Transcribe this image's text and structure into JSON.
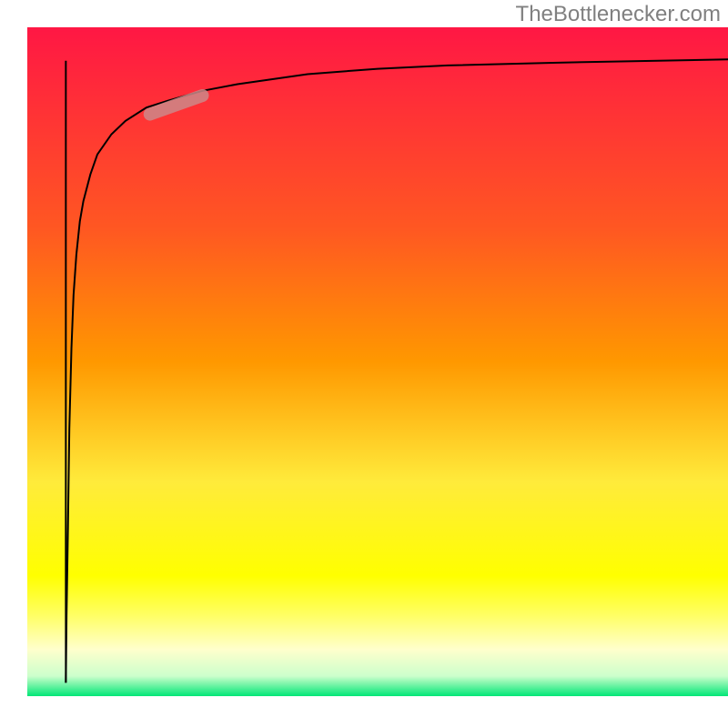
{
  "watermark": "TheBottlenecker.com",
  "chart_data": {
    "type": "line",
    "title": "",
    "xlabel": "",
    "ylabel": "",
    "xlim": [
      0,
      100
    ],
    "ylim": [
      0,
      100
    ],
    "background_gradient": {
      "stops": [
        {
          "offset": 0,
          "color": "#ff1744"
        },
        {
          "offset": 0.3,
          "color": "#ff5722"
        },
        {
          "offset": 0.5,
          "color": "#ff9800"
        },
        {
          "offset": 0.68,
          "color": "#ffeb3b"
        },
        {
          "offset": 0.82,
          "color": "#ffff00"
        },
        {
          "offset": 0.88,
          "color": "#ffff66"
        },
        {
          "offset": 0.93,
          "color": "#ffffcc"
        },
        {
          "offset": 0.97,
          "color": "#ccffcc"
        },
        {
          "offset": 1.0,
          "color": "#00e676"
        }
      ]
    },
    "series": [
      {
        "name": "curve",
        "type": "line",
        "color": "#000000",
        "width": 2,
        "x": [
          5.5,
          5.6,
          5.8,
          6.0,
          6.3,
          6.6,
          7.0,
          7.5,
          8.0,
          9.0,
          10.0,
          12.0,
          14.0,
          17.0,
          20.0,
          25.0,
          30.0,
          40.0,
          50.0,
          60.0,
          75.0,
          90.0,
          100.0
        ],
        "y": [
          2.0,
          12.0,
          25.0,
          40.0,
          52.0,
          60.0,
          66.0,
          71.0,
          74.0,
          78.0,
          81.0,
          84.0,
          86.0,
          88.0,
          89.0,
          90.5,
          91.5,
          93.0,
          93.8,
          94.3,
          94.7,
          95.0,
          95.2
        ]
      },
      {
        "name": "vertical-line",
        "type": "line",
        "color": "#000000",
        "width": 2,
        "x": [
          5.5,
          5.5
        ],
        "y": [
          95.0,
          2.0
        ]
      },
      {
        "name": "highlight",
        "type": "segment",
        "color": "#cc8888",
        "width": 14,
        "opacity": 0.85,
        "x": [
          17.5,
          25.0
        ],
        "y": [
          87.0,
          89.8
        ]
      }
    ]
  }
}
